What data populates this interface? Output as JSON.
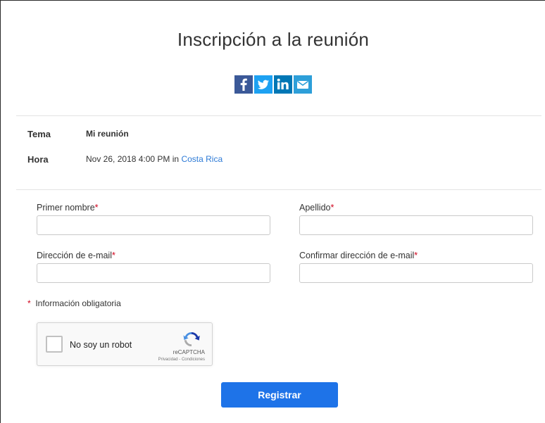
{
  "header": {
    "title": "Inscripción a la reunión"
  },
  "share": {
    "facebook_color": "#3b5998",
    "twitter_color": "#1da1f2",
    "linkedin_color": "#0077b5",
    "email_color": "#2d9fd9"
  },
  "meeting": {
    "topic_label": "Tema",
    "topic_value": "Mi reunión",
    "time_label": "Hora",
    "time_value": "Nov 26, 2018 4:00 PM in",
    "timezone": "Costa Rica"
  },
  "form": {
    "first_name_label": "Primer nombre",
    "last_name_label": "Apellido",
    "email_label": "Dirección de e-mail",
    "confirm_email_label": "Confirmar dirección de e-mail",
    "required_marker": "*",
    "required_note": "Información obligatoria"
  },
  "captcha": {
    "label": "No soy un robot",
    "brand": "reCAPTCHA",
    "terms": "Privacidad - Condiciones"
  },
  "submit": {
    "label": "Registrar",
    "color": "#1e73e8"
  }
}
